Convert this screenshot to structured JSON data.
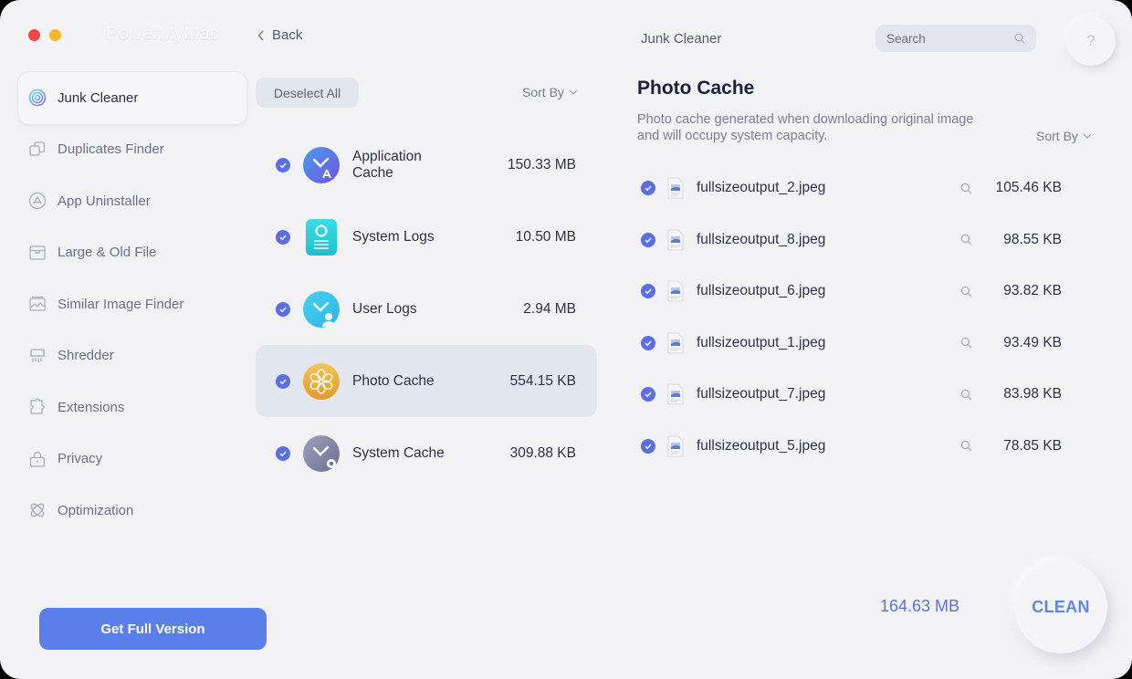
{
  "window": {
    "app_name": "PowerMyMac",
    "back_label": "Back",
    "section_title": "Junk Cleaner"
  },
  "search": {
    "placeholder": "Search",
    "value": ""
  },
  "help": {
    "label": "?"
  },
  "sidebar": {
    "items": [
      {
        "label": "Junk Cleaner",
        "icon": "junk-cleaner-icon",
        "active": true
      },
      {
        "label": "Duplicates Finder",
        "icon": "duplicates-icon",
        "active": false
      },
      {
        "label": "App Uninstaller",
        "icon": "app-uninstaller-icon",
        "active": false
      },
      {
        "label": "Large & Old File",
        "icon": "archive-box-icon",
        "active": false
      },
      {
        "label": "Similar Image Finder",
        "icon": "image-icon",
        "active": false
      },
      {
        "label": "Shredder",
        "icon": "shredder-icon",
        "active": false
      },
      {
        "label": "Extensions",
        "icon": "puzzle-icon",
        "active": false
      },
      {
        "label": "Privacy",
        "icon": "lock-icon",
        "active": false
      },
      {
        "label": "Optimization",
        "icon": "atom-icon",
        "active": false
      }
    ],
    "get_full_label": "Get Full Version"
  },
  "categories": {
    "deselect_label": "Deselect All",
    "sort_label": "Sort By",
    "items": [
      {
        "name": "Application Cache",
        "size": "150.33 MB",
        "checked": true,
        "selected": false,
        "icon": "application-cache-icon"
      },
      {
        "name": "System Logs",
        "size": "10.50 MB",
        "checked": true,
        "selected": false,
        "icon": "system-logs-icon"
      },
      {
        "name": "User Logs",
        "size": "2.94 MB",
        "checked": true,
        "selected": false,
        "icon": "user-logs-icon"
      },
      {
        "name": "Photo Cache",
        "size": "554.15 KB",
        "checked": true,
        "selected": true,
        "icon": "photo-cache-icon"
      },
      {
        "name": "System Cache",
        "size": "309.88 KB",
        "checked": true,
        "selected": false,
        "icon": "system-cache-icon"
      }
    ]
  },
  "detail": {
    "title": "Photo Cache",
    "description": "Photo cache generated when downloading original image and will occupy system capacity.",
    "sort_label": "Sort By",
    "files": [
      {
        "name": "fullsizeoutput_2.jpeg",
        "size": "105.46 KB",
        "checked": true
      },
      {
        "name": "fullsizeoutput_8.jpeg",
        "size": "98.55 KB",
        "checked": true
      },
      {
        "name": "fullsizeoutput_6.jpeg",
        "size": "93.82 KB",
        "checked": true
      },
      {
        "name": "fullsizeoutput_1.jpeg",
        "size": "93.49 KB",
        "checked": true
      },
      {
        "name": "fullsizeoutput_7.jpeg",
        "size": "83.98 KB",
        "checked": true
      },
      {
        "name": "fullsizeoutput_5.jpeg",
        "size": "78.85 KB",
        "checked": true
      }
    ]
  },
  "footer": {
    "total_size": "164.63 MB",
    "clean_label": "CLEAN"
  },
  "colors": {
    "accent": "#5b7fe8",
    "check": "#5a6fe4",
    "close": "#f1474b",
    "minimize": "#f7b82d",
    "total_text": "#5b74dc"
  }
}
